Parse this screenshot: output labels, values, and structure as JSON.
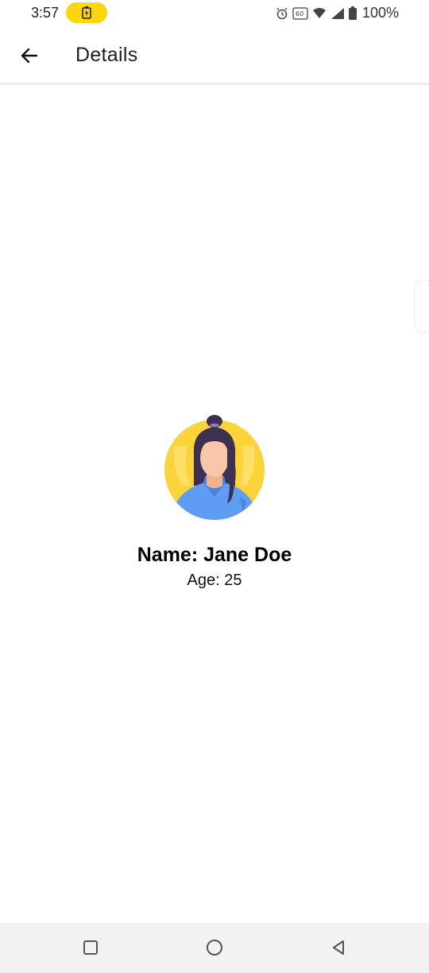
{
  "status_bar": {
    "time": "3:57",
    "battery_percent": "100%",
    "icons": [
      "charging-battery-icon",
      "alarm-icon",
      "hd-icon",
      "wifi-icon",
      "signal-icon",
      "battery-icon"
    ]
  },
  "app_bar": {
    "title": "Details",
    "back_icon": "arrow-back-icon"
  },
  "profile": {
    "name": "Name: Jane Doe",
    "age": "Age: 25",
    "avatar": "woman-avatar-illustration"
  },
  "nav_bar": {
    "icons": [
      "recent-apps-icon",
      "home-icon",
      "back-triangle-icon"
    ]
  },
  "colors": {
    "accent_yellow": "#ffd60a",
    "avatar_bg": "#fcd339",
    "shirt_blue": "#5f9df5",
    "hair_dark": "#3c3150",
    "skin": "#f8c6a8"
  }
}
